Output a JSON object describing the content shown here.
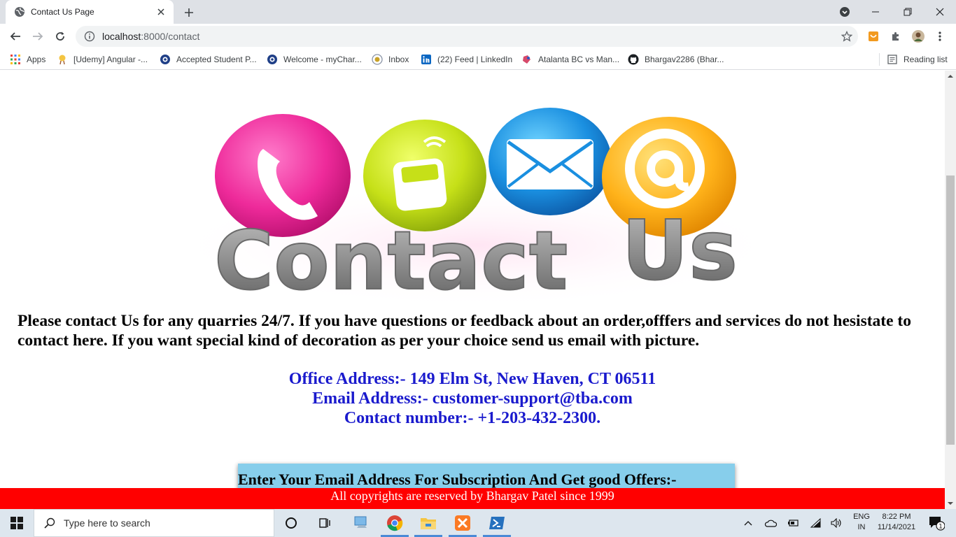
{
  "browser": {
    "tab": {
      "title": "Contact Us Page"
    },
    "address_bar": {
      "host": "localhost",
      "path": ":8000/contact"
    },
    "bookmarks": [
      {
        "label": "Apps",
        "icon": "apps-grid-icon"
      },
      {
        "label": "[Udemy] Angular -...",
        "icon": "udemy-icon"
      },
      {
        "label": "Accepted Student P...",
        "icon": "university-icon"
      },
      {
        "label": "Welcome - myChar...",
        "icon": "university-icon"
      },
      {
        "label": "Inbox",
        "icon": "inbox-icon"
      },
      {
        "label": "(22) Feed | LinkedIn",
        "icon": "linkedin-icon"
      },
      {
        "label": "Atalanta BC vs Man...",
        "icon": "soccer-icon"
      },
      {
        "label": "Bhargav2286 (Bhar...",
        "icon": "github-icon"
      }
    ],
    "reading_list": "Reading list"
  },
  "page": {
    "hero": {
      "word1": "Contact",
      "word2": "Us"
    },
    "intro": "Please contact Us for any quarries 24/7. If you have questions or feedback about an order,offfers and services do not hesistate to contact here. If you want special kind of decoration as per your choice send us email with picture.",
    "office_address": "Office Address:- 149 Elm St, New Haven, CT 06511",
    "email_address": "Email Address:- customer-support@tba.com",
    "contact_number": "Contact number:- +1-203-432-2300.",
    "subscribe_heading": "Enter Your Email Address For Subscription And Get good Offers:-",
    "footer": "All copyrights are reserved by Bhargav Patel since 1999"
  },
  "taskbar": {
    "search_placeholder": "Type here to search",
    "lang_top": "ENG",
    "lang_bottom": "IN",
    "time": "8:22 PM",
    "date": "11/14/2021",
    "notification_count": "1"
  },
  "colors": {
    "address_blue": "#1a1acd",
    "footer_red": "#ff0000",
    "subscribe_bg": "#87ceeb"
  }
}
